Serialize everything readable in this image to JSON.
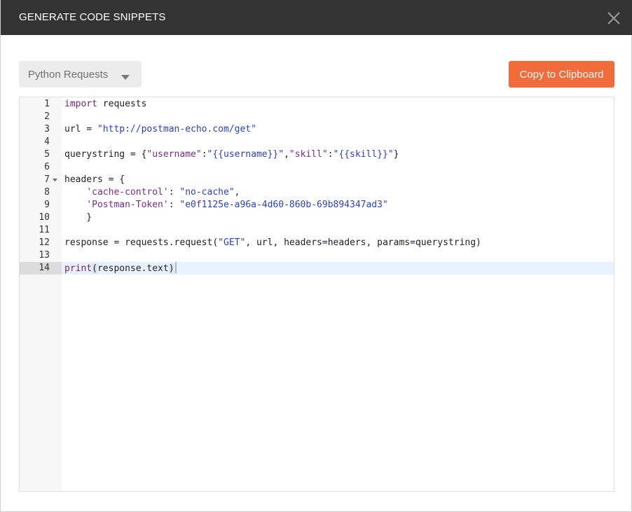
{
  "dialog": {
    "title": "GENERATE CODE SNIPPETS",
    "close_icon": "close-icon"
  },
  "toolbar": {
    "language_selected": "Python Requests",
    "dropdown_icon": "caret-down-icon",
    "copy_label": "Copy to Clipboard",
    "copy_color": "#f26b3a"
  },
  "editor": {
    "active_line": 14,
    "line_numbers": [
      "1",
      "2",
      "3",
      "4",
      "5",
      "6",
      "7",
      "8",
      "9",
      "10",
      "11",
      "12",
      "13",
      "14"
    ],
    "lines": [
      [
        {
          "t": "import",
          "c": "kw"
        },
        {
          "t": " requests",
          "c": "plain"
        }
      ],
      [],
      [
        {
          "t": "url",
          "c": "plain"
        },
        {
          "t": " = ",
          "c": "op"
        },
        {
          "t": "\"http://postman-echo.com/get\"",
          "c": "str"
        }
      ],
      [],
      [
        {
          "t": "querystring",
          "c": "plain"
        },
        {
          "t": " = {",
          "c": "plain"
        },
        {
          "t": "\"username\"",
          "c": "str-alt"
        },
        {
          "t": ":",
          "c": "plain"
        },
        {
          "t": "\"{{username}}\"",
          "c": "str"
        },
        {
          "t": ",",
          "c": "plain"
        },
        {
          "t": "\"skill\"",
          "c": "str-alt"
        },
        {
          "t": ":",
          "c": "plain"
        },
        {
          "t": "\"{{skill}}\"",
          "c": "str"
        },
        {
          "t": "}",
          "c": "plain"
        }
      ],
      [],
      [
        {
          "t": "headers",
          "c": "plain"
        },
        {
          "t": " = {",
          "c": "plain"
        }
      ],
      [
        {
          "t": "    ",
          "c": "plain"
        },
        {
          "t": "'cache-control'",
          "c": "str-alt"
        },
        {
          "t": ": ",
          "c": "plain"
        },
        {
          "t": "\"no-cache\"",
          "c": "str"
        },
        {
          "t": ",",
          "c": "plain"
        }
      ],
      [
        {
          "t": "    ",
          "c": "plain"
        },
        {
          "t": "'Postman-Token'",
          "c": "str-alt"
        },
        {
          "t": ": ",
          "c": "plain"
        },
        {
          "t": "\"e0f1125e-a96a-4d60-860b-69b894347ad3\"",
          "c": "str"
        }
      ],
      [
        {
          "t": "    }",
          "c": "plain"
        }
      ],
      [],
      [
        {
          "t": "response",
          "c": "plain"
        },
        {
          "t": " = ",
          "c": "op"
        },
        {
          "t": "requests.request(",
          "c": "plain"
        },
        {
          "t": "\"GET\"",
          "c": "str"
        },
        {
          "t": ", url, headers",
          "c": "plain"
        },
        {
          "t": "=",
          "c": "op"
        },
        {
          "t": "headers, params",
          "c": "plain"
        },
        {
          "t": "=",
          "c": "op"
        },
        {
          "t": "querystring)",
          "c": "plain"
        }
      ],
      [],
      [
        {
          "t": "print",
          "c": "kw"
        },
        {
          "t": "(",
          "c": "paren"
        },
        {
          "t": "response.text",
          "c": "plain"
        },
        {
          "t": ")",
          "c": "paren"
        }
      ]
    ],
    "fold_lines": [
      7
    ]
  }
}
